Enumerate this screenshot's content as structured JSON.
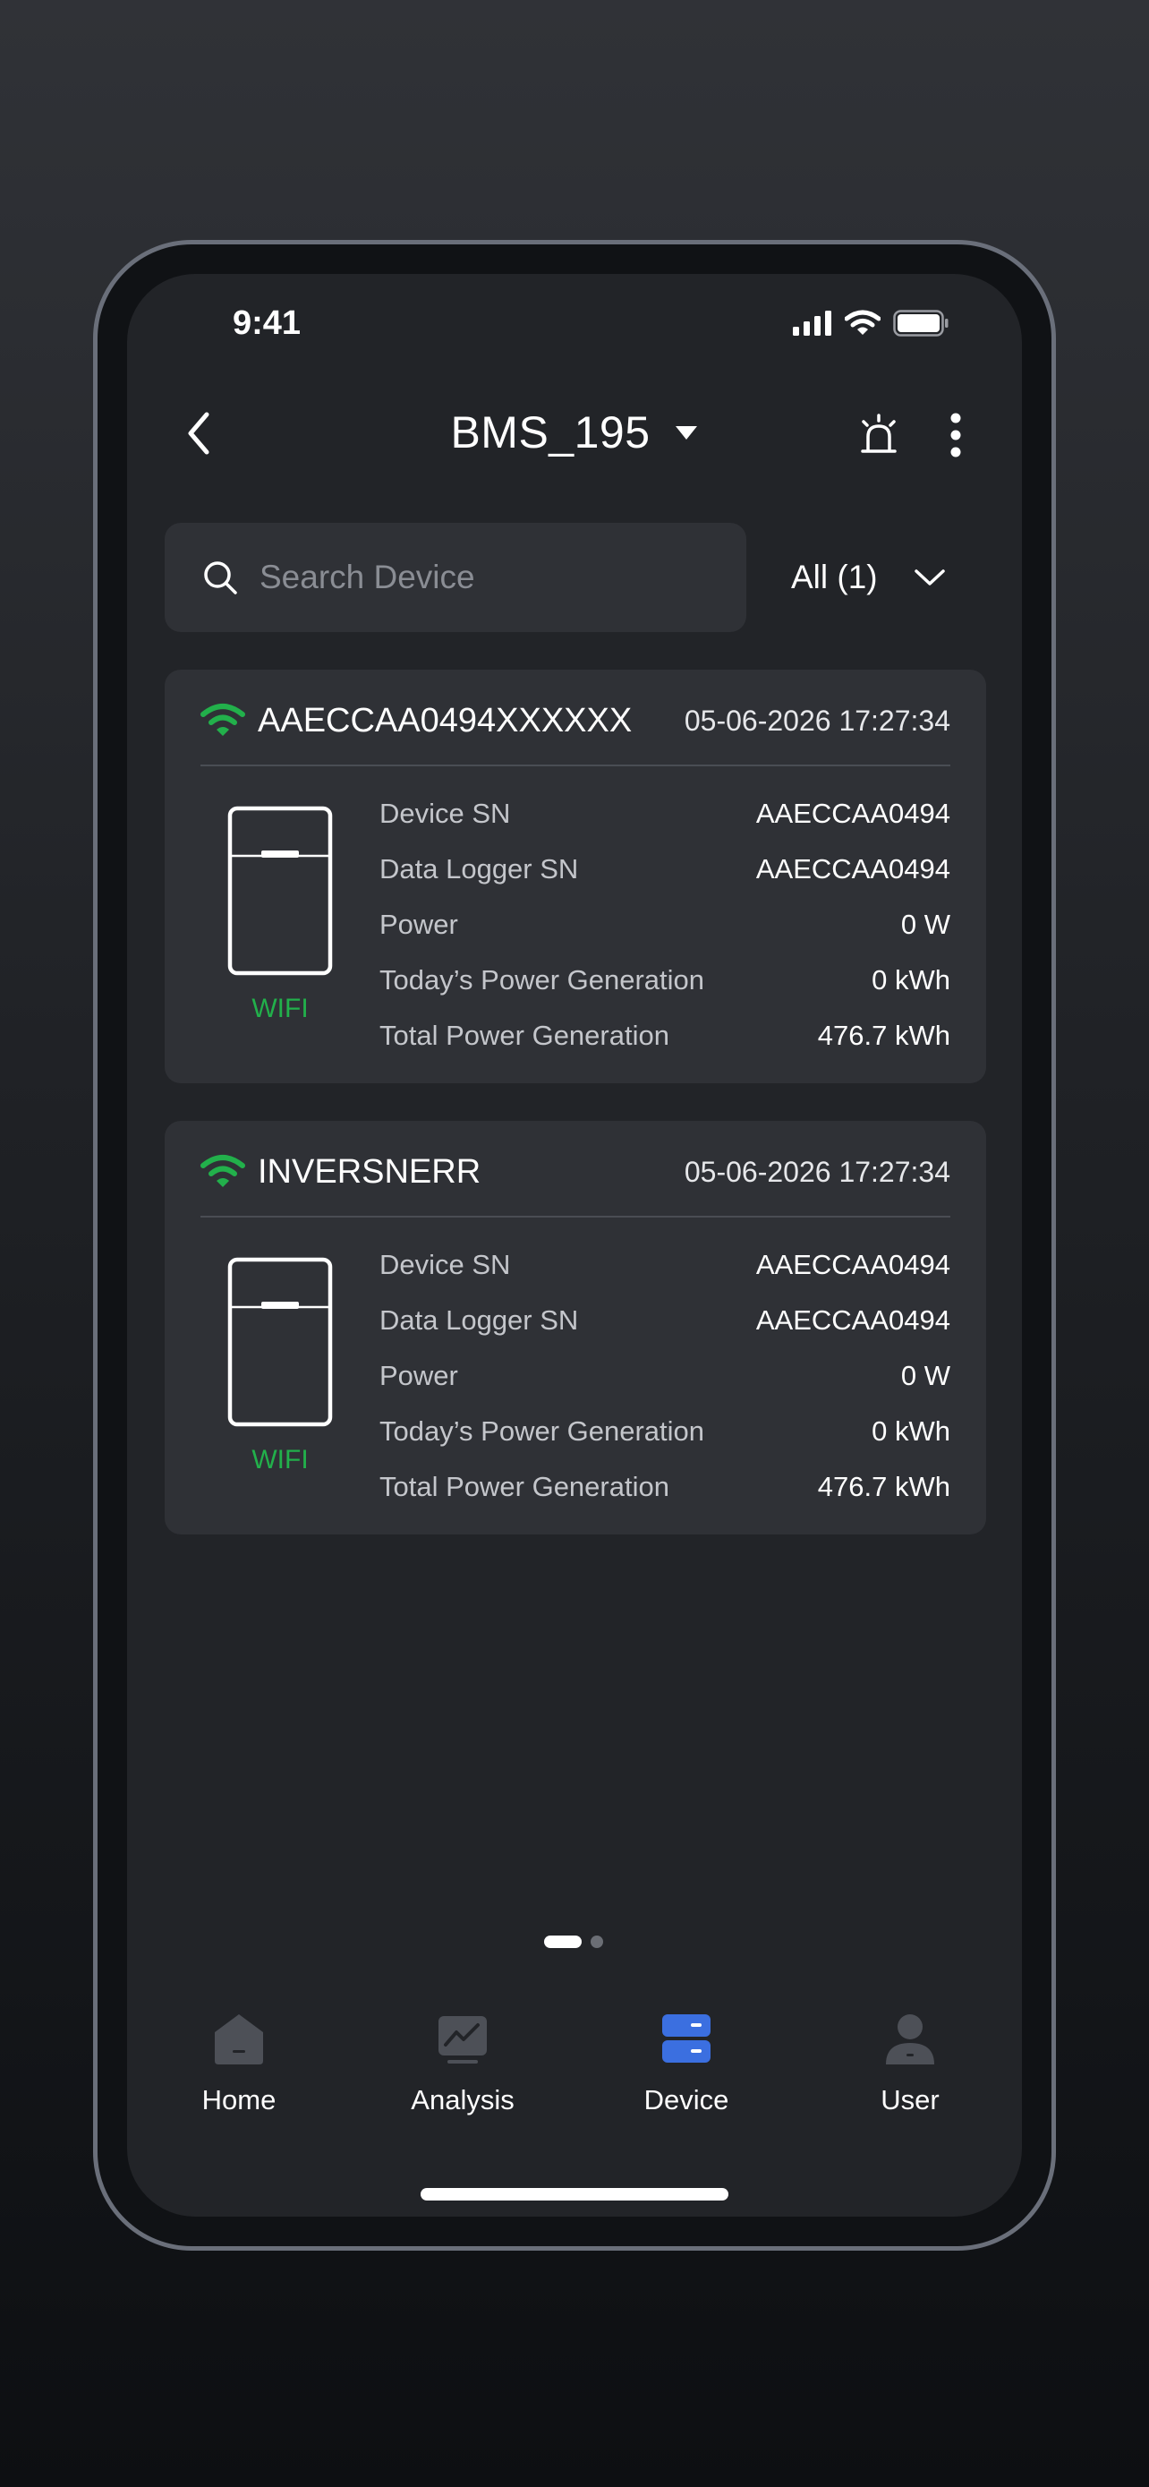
{
  "status_bar": {
    "time": "9:41"
  },
  "header": {
    "title": "BMS_195"
  },
  "search": {
    "placeholder": "Search Device"
  },
  "filter": {
    "label": "All (1)"
  },
  "devices": [
    {
      "name": "AAECCAA0494XXXXXX",
      "timestamp": "05-06-2026 17:27:34",
      "connection": "WIFI",
      "fields": [
        {
          "label": "Device SN",
          "value": "AAECCAA0494"
        },
        {
          "label": "Data Logger SN",
          "value": "AAECCAA0494"
        },
        {
          "label": "Power",
          "value": "0 W"
        },
        {
          "label": "Today’s Power Generation",
          "value": "0 kWh"
        },
        {
          "label": "Total Power Generation",
          "value": "476.7 kWh"
        }
      ]
    },
    {
      "name": "INVERSNERR",
      "timestamp": "05-06-2026 17:27:34",
      "connection": "WIFI",
      "fields": [
        {
          "label": "Device SN",
          "value": "AAECCAA0494"
        },
        {
          "label": "Data Logger SN",
          "value": "AAECCAA0494"
        },
        {
          "label": "Power",
          "value": "0 W"
        },
        {
          "label": "Today’s Power Generation",
          "value": "0 kWh"
        },
        {
          "label": "Total Power Generation",
          "value": "476.7 kWh"
        }
      ]
    }
  ],
  "page_indicator": {
    "active_index": 0,
    "total": 2
  },
  "tab_bar": {
    "active": "device",
    "items": [
      {
        "label": "Home",
        "icon": "home-icon"
      },
      {
        "label": "Analysis",
        "icon": "analysis-icon"
      },
      {
        "label": "Device",
        "icon": "device-icon"
      },
      {
        "label": "User",
        "icon": "user-icon"
      }
    ]
  },
  "colors": {
    "accent": "#3b6fe0",
    "wifi_green": "#22b04b",
    "card_bg": "#2f3136",
    "screen_bg": "#222428",
    "inactive_icon": "#4d5057"
  }
}
